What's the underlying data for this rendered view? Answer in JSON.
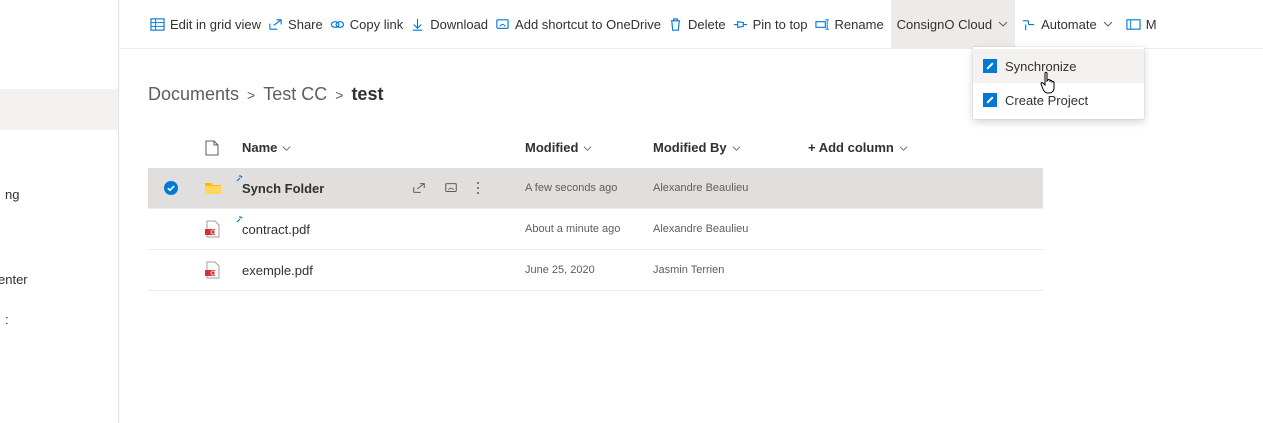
{
  "leftnav": {
    "items": [
      "ng",
      "enter",
      ":"
    ]
  },
  "toolbar": {
    "edit_grid": "Edit in grid view",
    "share": "Share",
    "copy_link": "Copy link",
    "download": "Download",
    "add_shortcut": "Add shortcut to OneDrive",
    "delete": "Delete",
    "pin_top": "Pin to top",
    "rename": "Rename",
    "consigno": "ConsignO Cloud",
    "automate": "Automate",
    "more": "M"
  },
  "menu": {
    "items": [
      "Synchronize",
      "Create Project"
    ]
  },
  "breadcrumb": {
    "items": [
      "Documents",
      "Test CC",
      "test"
    ],
    "separator": ">"
  },
  "list": {
    "headers": {
      "name": "Name",
      "modified": "Modified",
      "modified_by": "Modified By",
      "add_column": "+ Add column"
    },
    "rows": [
      {
        "name": "Synch Folder",
        "modified": "A few seconds ago",
        "modified_by": "Alexandre Beaulieu",
        "type": "folder",
        "selected": true,
        "new": true
      },
      {
        "name": "contract.pdf",
        "modified": "About a minute ago",
        "modified_by": "Alexandre Beaulieu",
        "type": "pdf",
        "selected": false,
        "new": true
      },
      {
        "name": "exemple.pdf",
        "modified": "June 25, 2020",
        "modified_by": "Jasmin Terrien",
        "type": "pdf",
        "selected": false,
        "new": false
      }
    ]
  },
  "colors": {
    "accent": "#0078d4",
    "folder": "#ffb900",
    "pdf": "#d13438",
    "selected_row": "#e1dfdd"
  }
}
